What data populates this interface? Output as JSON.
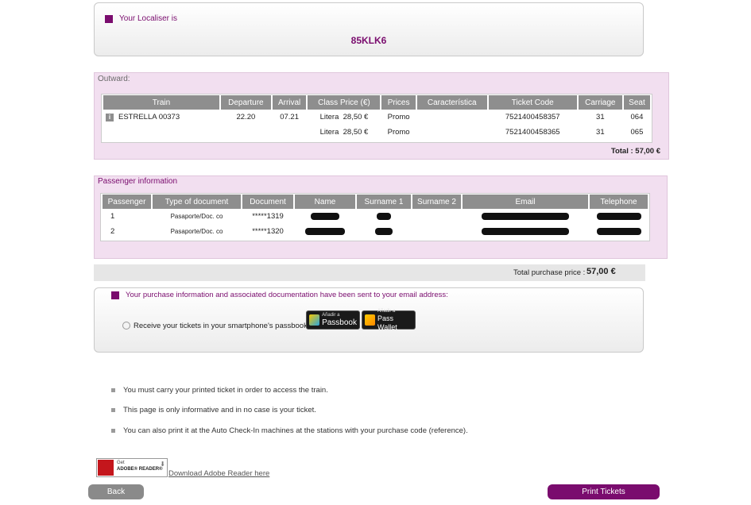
{
  "localiser": {
    "label": "Your Localiser is",
    "code": "85KLK6"
  },
  "outward": {
    "title": "Outward:",
    "headers": [
      "Train",
      "Departure",
      "Arrival",
      "Class Price (€)",
      "Prices",
      "Característica",
      "Ticket Code",
      "Carriage",
      "Seat"
    ],
    "rows": [
      {
        "train": "ESTRELLA 00373",
        "departure": "22.20",
        "arrival": "07.21",
        "class": "Litera",
        "price": "28,50 €",
        "prices": "Promo",
        "caracteristica": "",
        "ticket_code": "7521400458357",
        "carriage": "31",
        "seat": "064"
      },
      {
        "train": "",
        "departure": "",
        "arrival": "",
        "class": "Litera",
        "price": "28,50 €",
        "prices": "Promo",
        "caracteristica": "",
        "ticket_code": "7521400458365",
        "carriage": "31",
        "seat": "065"
      }
    ],
    "total": "Total : 57,00 €"
  },
  "passengers": {
    "title": "Passenger information",
    "headers": [
      "Passenger",
      "Type of document",
      "Document",
      "Name",
      "Surname 1",
      "Surname 2",
      "Email",
      "Telephone"
    ],
    "rows": [
      {
        "passenger": "1",
        "type": "Pasaporte/Doc. co",
        "document": "*****1319"
      },
      {
        "passenger": "2",
        "type": "Pasaporte/Doc. co",
        "document": "*****1320"
      }
    ]
  },
  "total_purchase": {
    "label": "Total purchase price :",
    "value": "57,00 €"
  },
  "email_notice": "Your purchase information and associated documentation have been sent to your email address:",
  "passbook": {
    "label": "Receive your tickets in your smartphone's passbook",
    "passbook_small": "Añadir a",
    "passbook_big": "Passbook",
    "wallet_small": "Añadir a",
    "wallet_big": "Pass Wallet"
  },
  "notes": [
    "You must carry your printed ticket in order to access the train.",
    "This page is only informative and in no case is your ticket.",
    "You can also print it at the Auto Check-In machines at the stations with your purchase code (reference)."
  ],
  "adobe": {
    "badge_small": "Get",
    "badge_big": "ADOBE® READER®",
    "link": "Download Adobe Reader here"
  },
  "buttons": {
    "back": "Back",
    "print": "Print Tickets"
  },
  "colors": {
    "accent": "#7a0c6e",
    "section_bar": "#f2dff0",
    "header_grey": "#8e8e8e"
  }
}
